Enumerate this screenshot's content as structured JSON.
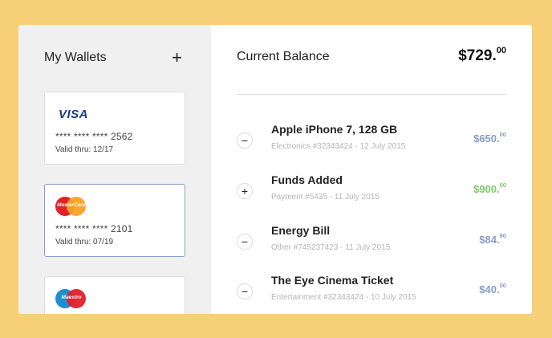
{
  "sidebar": {
    "title": "My Wallets",
    "add_label": "+",
    "cards": [
      {
        "brand": "VISA",
        "number": "**** **** **** 2562",
        "valid": "Valid thru: 12/17"
      },
      {
        "brand": "MasterCard",
        "number": "**** **** **** 2101",
        "valid": "Valid thru: 07/19"
      },
      {
        "brand": "Maestro"
      }
    ]
  },
  "main": {
    "balance_label": "Current Balance",
    "balance_whole": "$729.",
    "balance_cents": "00",
    "transactions": [
      {
        "icon": "−",
        "title": "Apple iPhone 7, 128 GB",
        "meta": "Electronics #32343424 - 12 July 2015",
        "amount_whole": "$650.",
        "amount_cents": "00",
        "color": "#8a9cc9"
      },
      {
        "icon": "+",
        "title": "Funds Added",
        "meta": "Payment #5435 - 11 July 2015",
        "amount_whole": "$900.",
        "amount_cents": "00",
        "color": "#7cc86c"
      },
      {
        "icon": "−",
        "title": "Energy Bill",
        "meta": "Other #745237423 - 11 July 2015",
        "amount_whole": "$84.",
        "amount_cents": "90",
        "color": "#8a9cc9"
      },
      {
        "icon": "−",
        "title": "The Eye Cinema Ticket",
        "meta": "Entertainment #32343424 - 10 July 2015",
        "amount_whole": "$40.",
        "amount_cents": "00",
        "color": "#8a9cc9"
      }
    ]
  },
  "colors": {
    "background": "#f7cf78",
    "debit": "#8a9cc9",
    "credit": "#7cc86c",
    "selected_border": "#8a9cc9"
  }
}
